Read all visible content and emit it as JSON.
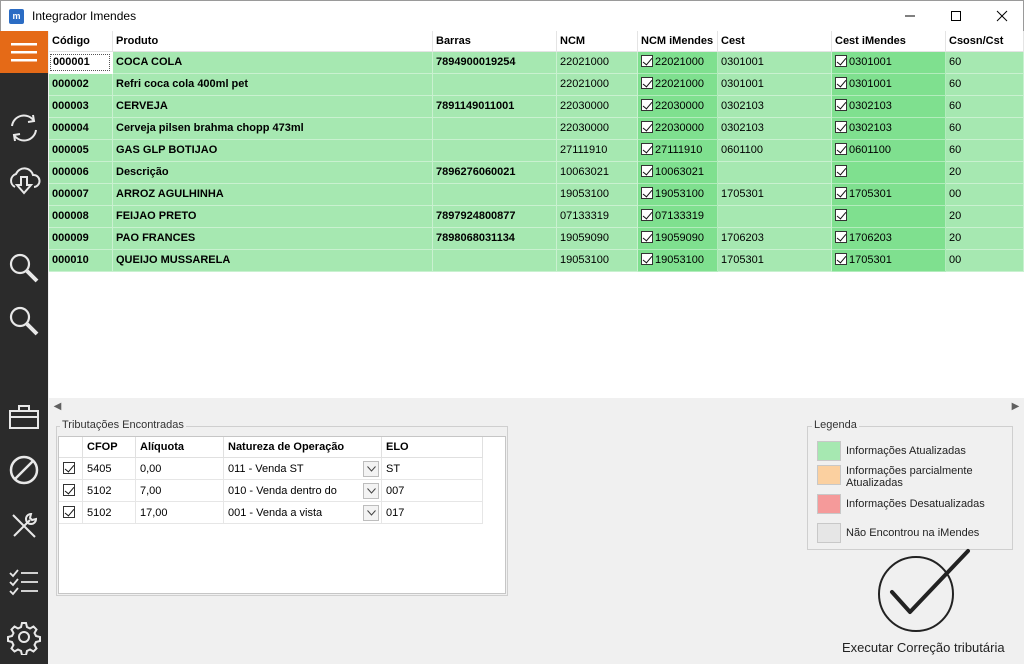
{
  "window": {
    "title": "Integrador Imendes"
  },
  "grid": {
    "columns": [
      "Código",
      "Produto",
      "Barras",
      "NCM",
      "NCM iMendes",
      "Cest",
      "Cest iMendes",
      "Csosn/Cst"
    ],
    "rows": [
      {
        "codigo": "000001",
        "produto": "COCA COLA",
        "barras": "7894900019254",
        "ncm": "22021000",
        "ncm_imendes": "22021000",
        "cest": "0301001",
        "cest_imendes": "0301001",
        "csosn": "60"
      },
      {
        "codigo": "000002",
        "produto": "Refri coca cola 400ml pet",
        "barras": "",
        "ncm": "22021000",
        "ncm_imendes": "22021000",
        "cest": "0301001",
        "cest_imendes": "0301001",
        "csosn": "60"
      },
      {
        "codigo": "000003",
        "produto": "CERVEJA",
        "barras": "7891149011001",
        "ncm": "22030000",
        "ncm_imendes": "22030000",
        "cest": "0302103",
        "cest_imendes": "0302103",
        "csosn": "60"
      },
      {
        "codigo": "000004",
        "produto": "Cerveja pilsen brahma chopp 473ml",
        "barras": "",
        "ncm": "22030000",
        "ncm_imendes": "22030000",
        "cest": "0302103",
        "cest_imendes": "0302103",
        "csosn": "60"
      },
      {
        "codigo": "000005",
        "produto": "GAS GLP BOTIJAO",
        "barras": "",
        "ncm": "27111910",
        "ncm_imendes": "27111910",
        "cest": "0601100",
        "cest_imendes": "0601100",
        "csosn": "60"
      },
      {
        "codigo": "000006",
        "produto": "Descrição",
        "barras": "7896276060021",
        "ncm": "10063021",
        "ncm_imendes": "10063021",
        "cest": "",
        "cest_imendes": "",
        "csosn": "20"
      },
      {
        "codigo": "000007",
        "produto": "ARROZ AGULHINHA",
        "barras": "",
        "ncm": "19053100",
        "ncm_imendes": "19053100",
        "cest": "1705301",
        "cest_imendes": "1705301",
        "csosn": "00"
      },
      {
        "codigo": "000008",
        "produto": "FEIJAO PRETO",
        "barras": "7897924800877",
        "ncm": "07133319",
        "ncm_imendes": "07133319",
        "cest": "",
        "cest_imendes": "",
        "csosn": "20"
      },
      {
        "codigo": "000009",
        "produto": "PAO FRANCES",
        "barras": "7898068031134",
        "ncm": "19059090",
        "ncm_imendes": "19059090",
        "cest": "1706203",
        "cest_imendes": "1706203",
        "csosn": "20"
      },
      {
        "codigo": "000010",
        "produto": "QUEIJO MUSSARELA",
        "barras": "",
        "ncm": "19053100",
        "ncm_imendes": "19053100",
        "cest": "1705301",
        "cest_imendes": "1705301",
        "csosn": "00"
      }
    ]
  },
  "tributacoes": {
    "title": "Tributações Encontradas",
    "columns": [
      "CFOP",
      "Alíquota",
      "Natureza de Operação",
      "ELO"
    ],
    "rows": [
      {
        "cfop": "5405",
        "aliquota": "0,00",
        "natureza": "011 - Venda ST",
        "elo": "ST"
      },
      {
        "cfop": "5102",
        "aliquota": "7,00",
        "natureza": "010 - Venda dentro do",
        "elo": "007"
      },
      {
        "cfop": "5102",
        "aliquota": "17,00",
        "natureza": "001 - Venda a vista",
        "elo": "017"
      }
    ]
  },
  "legenda": {
    "title": "Legenda",
    "items": [
      {
        "label": "Informações Atualizadas",
        "color": "#a6e8b1"
      },
      {
        "label": "Informações parcialmente Atualizadas",
        "color": "#fbd0a0"
      },
      {
        "label": "Informações Desatualizadas",
        "color": "#f59a9a"
      },
      {
        "label": "Não Encontrou na iMendes",
        "color": "#e6e6e6"
      }
    ]
  },
  "actions": {
    "execute_label": "Executar Correção tributária"
  },
  "colors": {
    "row_green": "#a6e8b1",
    "cell_green_dark": "#7fe08f",
    "sidebar": "#2b2b2b",
    "menu_accent": "#e56a17"
  },
  "sidebar_icons": [
    "menu-icon",
    "refresh-icon",
    "download-icon",
    "search-icon",
    "search-icon",
    "toolbox-icon",
    "block-icon",
    "tools-icon",
    "checklist-icon",
    "settings-icon"
  ]
}
